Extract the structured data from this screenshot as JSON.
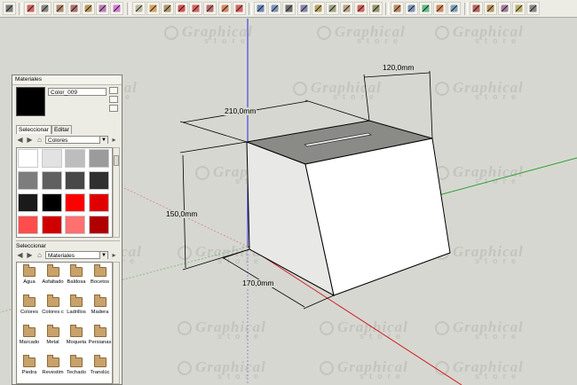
{
  "toolbar": {
    "tools": [
      "select-arrow-icon",
      "pencil-icon",
      "line-icon",
      "rectangle-icon",
      "circle-icon",
      "arc-icon",
      "polygon-icon",
      "eraser-icon",
      "tape-measure-icon",
      "paint-bucket-icon",
      "push-pull-icon",
      "move-icon",
      "rotate-icon",
      "offset-icon",
      "follow-me-icon",
      "scale-icon",
      "orbit-icon",
      "pan-icon",
      "zoom-icon",
      "zoom-extents-icon",
      "zoom-window-icon",
      "dimension-icon",
      "protractor-icon",
      "text-icon",
      "axes-icon",
      "3d-text-icon",
      "section-plane-icon",
      "walk-icon",
      "position-camera-icon",
      "look-around-icon",
      "components-icon",
      "styles-icon",
      "shadows-icon",
      "fog-icon",
      "last-tool-icon"
    ]
  },
  "watermark": {
    "line1": "Graphical",
    "line2": "store"
  },
  "model": {
    "dimensions": {
      "width": "210,0mm",
      "depth": "120,0mm",
      "height": "150,0mm",
      "bottom": "170,0mm"
    }
  },
  "materials_panel": {
    "title": "Materiales",
    "material_name": "Color_009",
    "selected_color": "#000000",
    "tabs": [
      "Seleccionar",
      "Editar"
    ],
    "library": "Colores",
    "swatches": [
      "#ffffff",
      "#e2e2e2",
      "#bdbdbd",
      "#9b9b9b",
      "#7d7d7d",
      "#606060",
      "#484848",
      "#303030",
      "#1a1a1a",
      "#000000",
      "#ff0000",
      "#e00000",
      "#ff4d4d",
      "#d00000",
      "#ff7070",
      "#b00000"
    ],
    "secondary_label": "Seleccionar",
    "secondary_library": "Materiales",
    "materials": [
      "Agua",
      "Asfaltado",
      "Baldosa",
      "Bocetos",
      "Colores",
      "Colores c",
      "Ladrillos",
      "Madera",
      "Marcado",
      "Metal",
      "Moqueta",
      "Persianas",
      "Piedra",
      "Revestim",
      "Techado",
      "Translúc"
    ]
  }
}
